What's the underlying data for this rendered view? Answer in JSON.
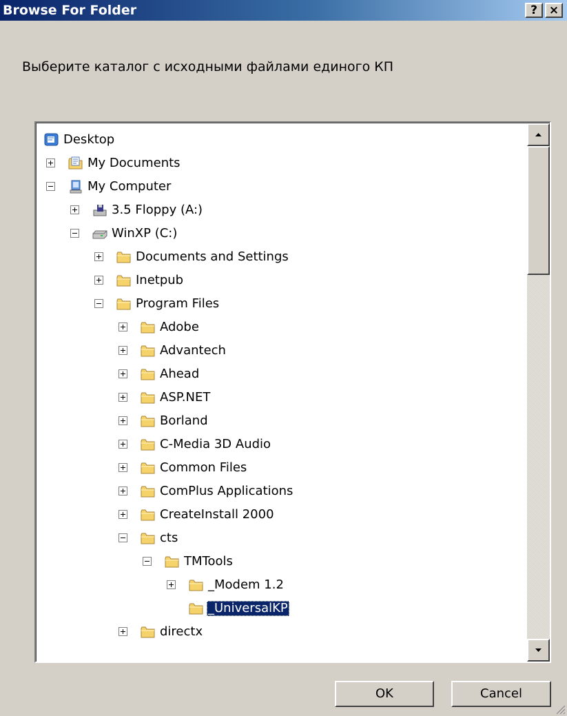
{
  "window": {
    "title": "Browse For Folder",
    "help_label": "?",
    "close_label": "×"
  },
  "prompt": "Выберите каталог с исходными файлами единого КП",
  "tree": {
    "items": [
      {
        "label": "Desktop",
        "level": 0,
        "expander": "none",
        "icon": "desktop-icon",
        "selected": false
      },
      {
        "label": "My Documents",
        "level": 1,
        "expander": "plus",
        "icon": "my-documents-icon",
        "selected": false
      },
      {
        "label": "My Computer",
        "level": 1,
        "expander": "minus",
        "icon": "my-computer-icon",
        "selected": false
      },
      {
        "label": "3.5 Floppy (A:)",
        "level": 2,
        "expander": "plus",
        "icon": "floppy-drive-icon",
        "selected": false
      },
      {
        "label": "WinXP (C:)",
        "level": 2,
        "expander": "minus",
        "icon": "hard-drive-icon",
        "selected": false
      },
      {
        "label": "Documents and Settings",
        "level": 3,
        "expander": "plus",
        "icon": "folder-icon",
        "selected": false
      },
      {
        "label": "Inetpub",
        "level": 3,
        "expander": "plus",
        "icon": "folder-icon",
        "selected": false
      },
      {
        "label": "Program Files",
        "level": 3,
        "expander": "minus",
        "icon": "folder-icon",
        "selected": false
      },
      {
        "label": "Adobe",
        "level": 4,
        "expander": "plus",
        "icon": "folder-icon",
        "selected": false
      },
      {
        "label": "Advantech",
        "level": 4,
        "expander": "plus",
        "icon": "folder-icon",
        "selected": false
      },
      {
        "label": "Ahead",
        "level": 4,
        "expander": "plus",
        "icon": "folder-icon",
        "selected": false
      },
      {
        "label": "ASP.NET",
        "level": 4,
        "expander": "plus",
        "icon": "folder-icon",
        "selected": false
      },
      {
        "label": "Borland",
        "level": 4,
        "expander": "plus",
        "icon": "folder-icon",
        "selected": false
      },
      {
        "label": "C-Media 3D Audio",
        "level": 4,
        "expander": "plus",
        "icon": "folder-icon",
        "selected": false
      },
      {
        "label": "Common Files",
        "level": 4,
        "expander": "plus",
        "icon": "folder-icon",
        "selected": false
      },
      {
        "label": "ComPlus Applications",
        "level": 4,
        "expander": "plus",
        "icon": "folder-icon",
        "selected": false
      },
      {
        "label": "CreateInstall 2000",
        "level": 4,
        "expander": "plus",
        "icon": "folder-icon",
        "selected": false
      },
      {
        "label": "cts",
        "level": 4,
        "expander": "minus",
        "icon": "folder-icon",
        "selected": false
      },
      {
        "label": "TMTools",
        "level": 5,
        "expander": "minus",
        "icon": "folder-icon",
        "selected": false
      },
      {
        "label": "_Modem 1.2",
        "level": 6,
        "expander": "plus",
        "icon": "folder-icon",
        "selected": false
      },
      {
        "label": "_UniversalKP",
        "level": 6,
        "expander": "none",
        "icon": "folder-icon",
        "selected": true
      },
      {
        "label": "directx",
        "level": 4,
        "expander": "plus",
        "icon": "folder-icon",
        "selected": false
      }
    ]
  },
  "buttons": {
    "ok_label": "OK",
    "cancel_label": "Cancel"
  },
  "colors": {
    "selection": "#0a246a",
    "folder": "#f6d26a",
    "titlebar_start": "#0a246a",
    "titlebar_end": "#a6caf0"
  }
}
